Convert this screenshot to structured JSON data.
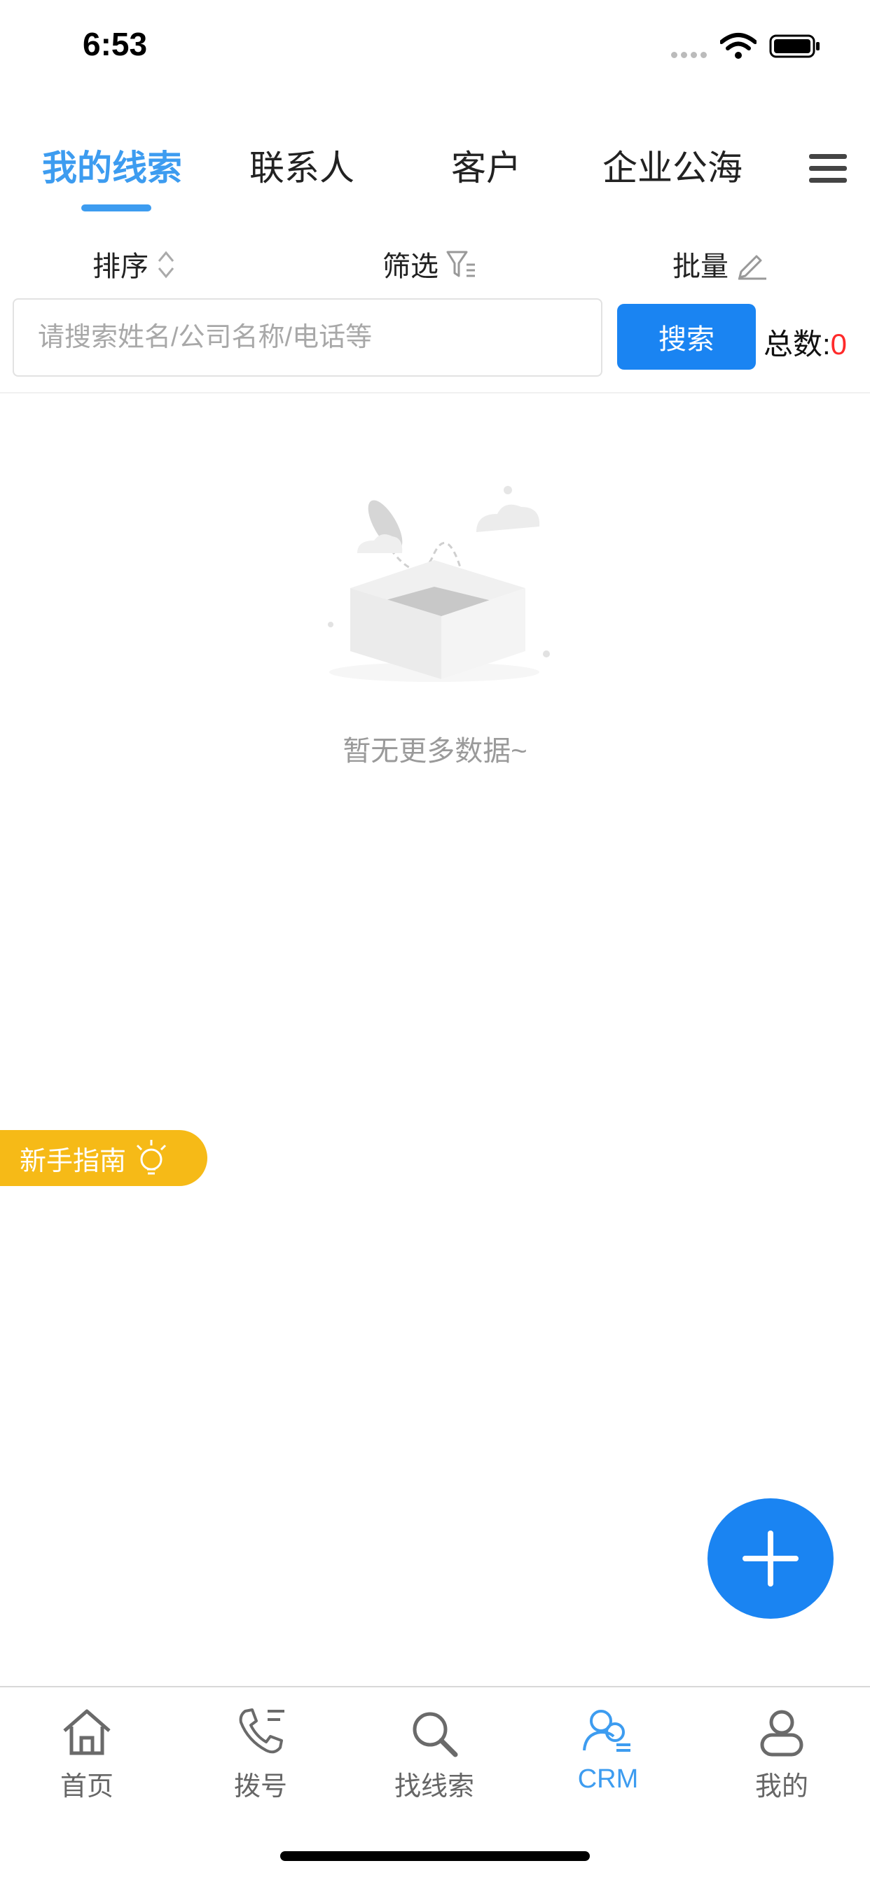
{
  "status_bar": {
    "time": "6:53"
  },
  "tabs": [
    {
      "label": "我的线索",
      "active": true
    },
    {
      "label": "联系人",
      "active": false
    },
    {
      "label": "客户",
      "active": false
    },
    {
      "label": "企业公海",
      "active": false
    }
  ],
  "toolbar": {
    "sort_label": "排序",
    "filter_label": "筛选",
    "batch_label": "批量"
  },
  "search": {
    "placeholder": "请搜索姓名/公司名称/电话等",
    "value": "",
    "button_label": "搜索",
    "total_label": "总数:",
    "total_value": "0"
  },
  "empty_state": {
    "text": "暂无更多数据~"
  },
  "guide": {
    "label": "新手指南"
  },
  "bottom_nav": [
    {
      "label": "首页",
      "icon": "home-icon",
      "active": false
    },
    {
      "label": "拨号",
      "icon": "phone-icon",
      "active": false
    },
    {
      "label": "找线索",
      "icon": "search-icon",
      "active": false
    },
    {
      "label": "CRM",
      "icon": "crm-icon",
      "active": true
    },
    {
      "label": "我的",
      "icon": "user-icon",
      "active": false
    }
  ],
  "colors": {
    "accent": "#3d9cf0",
    "button": "#1a84f2",
    "guide": "#f6ba17",
    "total_number": "#ff2a2a"
  }
}
